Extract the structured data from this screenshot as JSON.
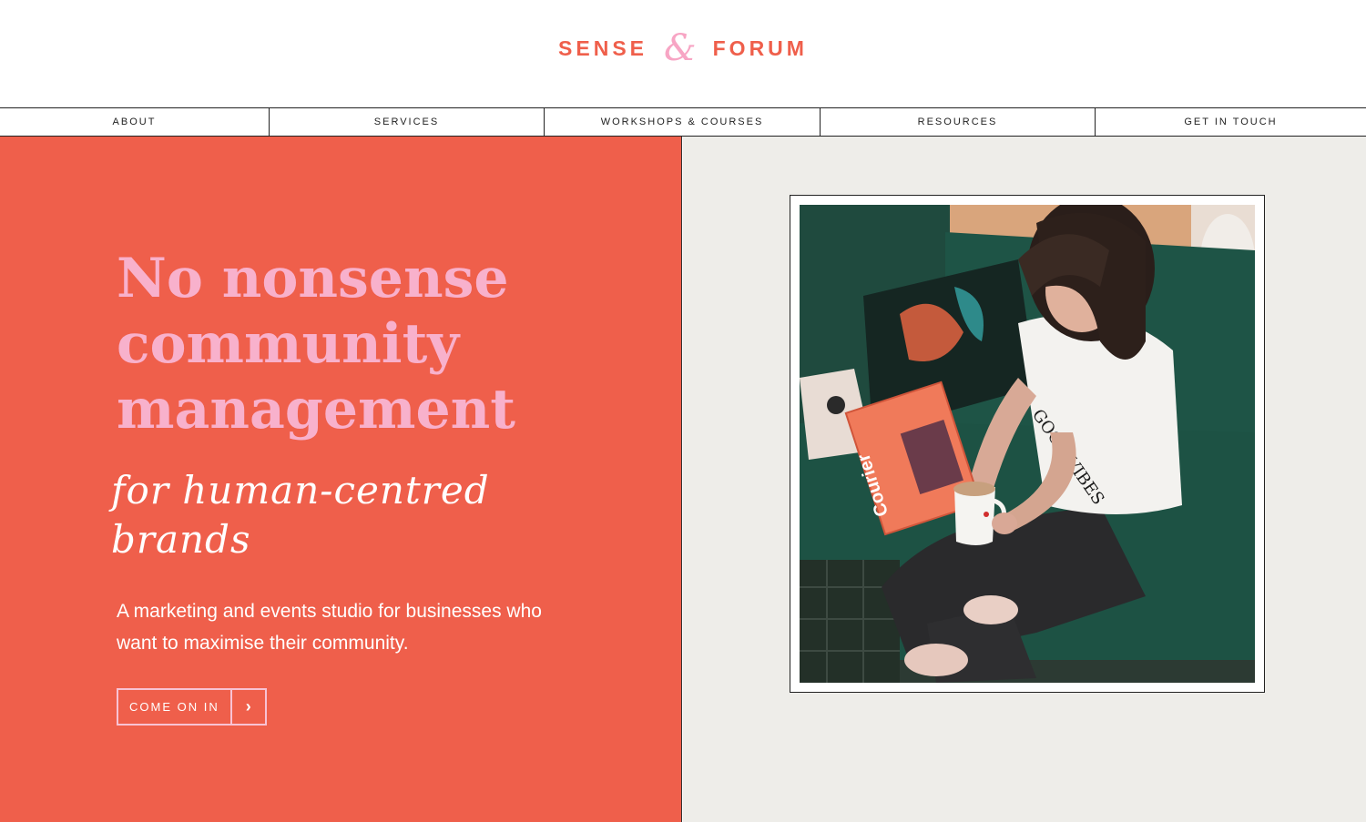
{
  "brand": {
    "word1": "SENSE",
    "amp": "&",
    "word2": "FORUM"
  },
  "nav": {
    "items": [
      {
        "label": "ABOUT"
      },
      {
        "label": "SERVICES"
      },
      {
        "label": "WORKSHOPS & COURSES"
      },
      {
        "label": "RESOURCES"
      },
      {
        "label": "GET IN TOUCH"
      }
    ]
  },
  "hero": {
    "headline_lines": [
      "No nonsense",
      "community",
      "management"
    ],
    "script_lines": [
      "for human-centred",
      "brands"
    ],
    "description": "A marketing and events studio for businesses who want to maximise their community.",
    "cta_label": "COME ON IN",
    "cta_arrow": "›"
  },
  "photo": {
    "magazine_text": "Courier",
    "shirt_text": "GOOD VIBES"
  },
  "colors": {
    "coral": "#ef5f4b",
    "pink": "#f8b1cc",
    "cream": "#eeede9"
  }
}
